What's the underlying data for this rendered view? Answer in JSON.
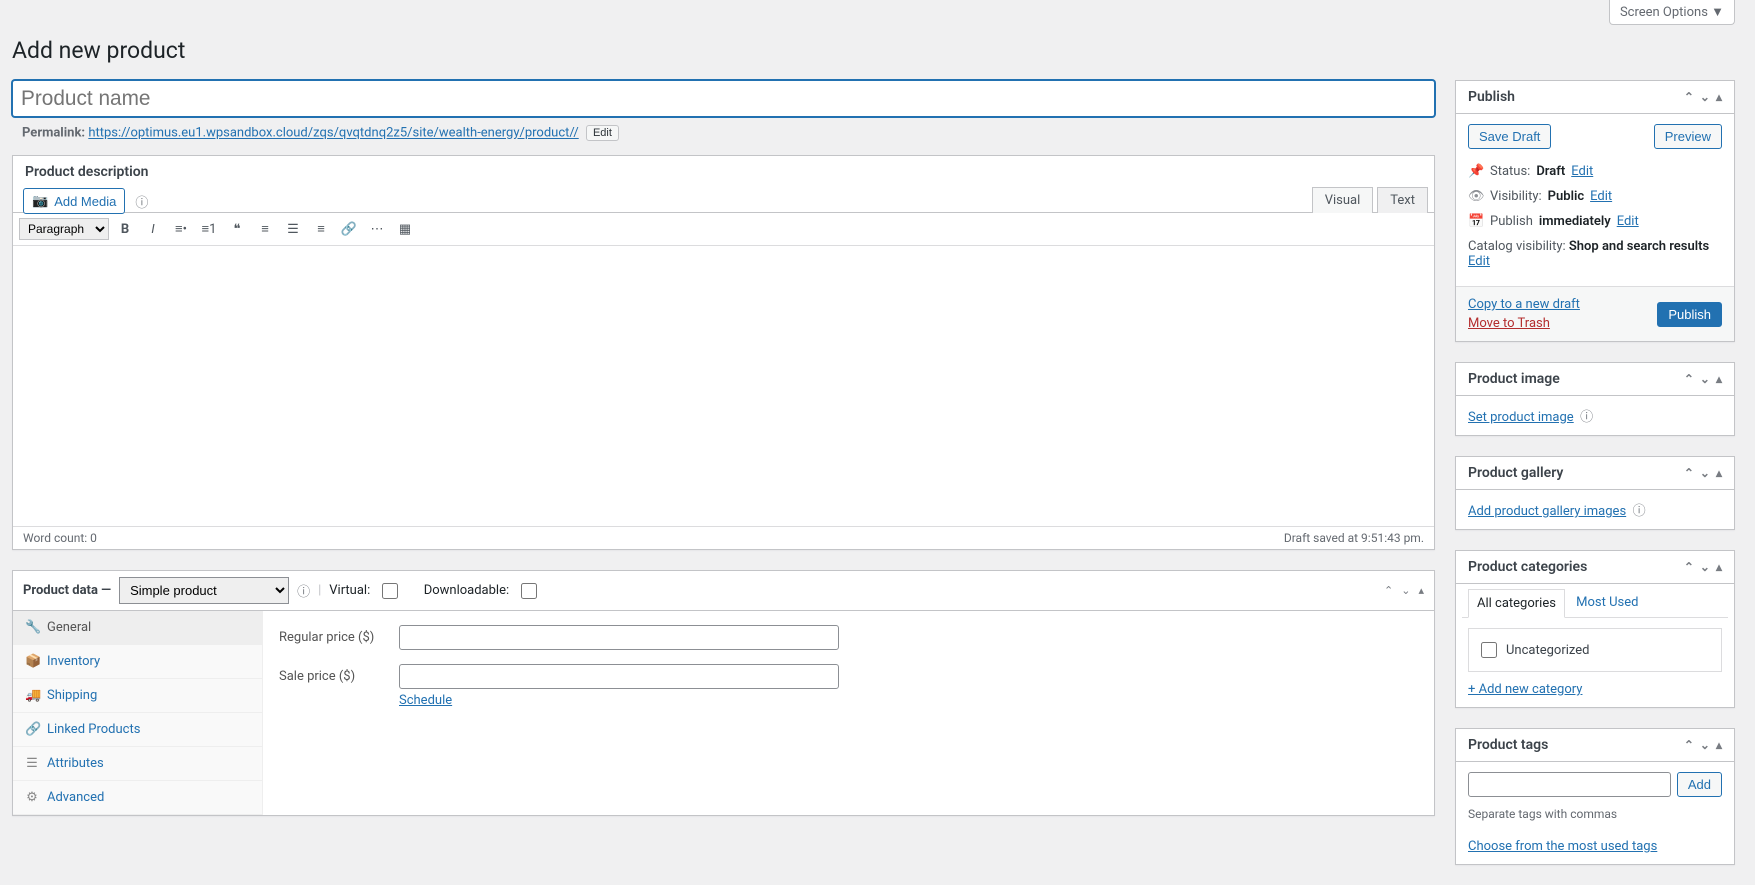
{
  "top": {
    "screen_options": "Screen Options ▼"
  },
  "page_title": "Add new product",
  "title_placeholder": "Product name",
  "permalink": {
    "label": "Permalink:",
    "url": "https://optimus.eu1.wpsandbox.cloud/zqs/qvqtdnq2z5/site/wealth-energy/product//",
    "edit": "Edit"
  },
  "editor": {
    "box_title": "Product description",
    "add_media": "Add Media",
    "tabs": {
      "visual": "Visual",
      "text": "Text"
    },
    "format_select": "Paragraph",
    "word_count_label": "Word count: 0",
    "draft_saved": "Draft saved at 9:51:43 pm."
  },
  "product_data": {
    "label": "Product data —",
    "type": "Simple product",
    "virtual_label": "Virtual:",
    "downloadable_label": "Downloadable:",
    "tabs": {
      "general": "General",
      "inventory": "Inventory",
      "shipping": "Shipping",
      "linked": "Linked Products",
      "attributes": "Attributes",
      "advanced": "Advanced"
    },
    "fields": {
      "regular_price": "Regular price ($)",
      "sale_price": "Sale price ($)",
      "schedule": "Schedule"
    }
  },
  "publish": {
    "title": "Publish",
    "save_draft": "Save Draft",
    "preview": "Preview",
    "status_label": "Status:",
    "status_value": "Draft",
    "visibility_label": "Visibility:",
    "visibility_value": "Public",
    "publish_label": "Publish",
    "publish_value": "immediately",
    "catalog_label": "Catalog visibility:",
    "catalog_value": "Shop and search results",
    "edit": "Edit",
    "copy_draft": "Copy to a new draft",
    "move_trash": "Move to Trash",
    "publish_btn": "Publish"
  },
  "product_image": {
    "title": "Product image",
    "link": "Set product image"
  },
  "product_gallery": {
    "title": "Product gallery",
    "link": "Add product gallery images"
  },
  "categories": {
    "title": "Product categories",
    "tab_all": "All categories",
    "tab_most": "Most Used",
    "uncategorized": "Uncategorized",
    "add_new": "+ Add new category"
  },
  "tags": {
    "title": "Product tags",
    "add": "Add",
    "hint": "Separate tags with commas",
    "choose": "Choose from the most used tags"
  }
}
